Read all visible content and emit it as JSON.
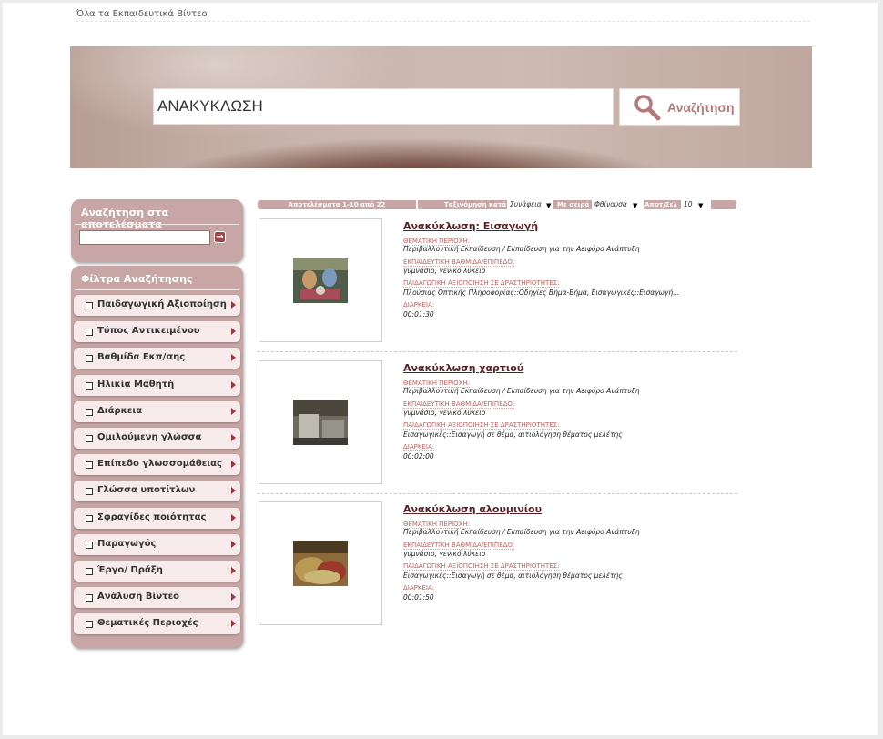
{
  "breadcrumb": "Όλα τα Εκπαιδευτικά Βίντεο",
  "search": {
    "value": "ΑΝΑΚΥΚΛΩΣΗ",
    "button_label": "Αναζήτηση"
  },
  "sidebar": {
    "search_title": "Αναζήτηση στα αποτελέσματα",
    "search_go": "→",
    "filters_title": "Φίλτρα Αναζήτησης",
    "filters": [
      "Παιδαγωγική Αξιοποίηση",
      "Τύπος Αντικειμένου",
      "Βαθμίδα Εκπ/σης",
      "Ηλικία Μαθητή",
      "Διάρκεια",
      "Ομιλούμενη γλώσσα",
      "Επίπεδο γλωσσομάθειας",
      "Γλώσσα υποτίτλων",
      "Σφραγίδες ποιότητας",
      "Παραγωγός",
      "Έργο/ Πράξη",
      "Ανάλυση Βίντεο",
      "Θεματικές Περιοχές"
    ]
  },
  "toolbar": {
    "results_count": "Αποτελέσματα 1-10 από 22",
    "sort_label": "Ταξινόμηση κατά",
    "sort_value": "Συνάφεια",
    "order_label": "Με σειρά",
    "order_value": "Φθίνουσα",
    "per_page_label": "Αποτ/Σελ",
    "per_page_value": "10",
    "dropdown_glyph": "▼"
  },
  "field_labels": {
    "subject": "ΘΕΜΑΤΙΚΗ ΠΕΡΙΟΧΗ:",
    "level": "ΕΚΠΑΙΔΕΥΤΙΚΗ ΒΑΘΜΙΔΑ/ΕΠΙΠΕΔΟ:",
    "pedagogy": "ΠΑΙΔΑΓΩΓΙΚΗ ΑΞΙΟΠΟΙΗΣΗ ΣΕ ΔΡΑΣΤΗΡΙΟΤΗΤΕΣ:",
    "duration": "ΔΙΑΡΚΕΙΑ:"
  },
  "results": [
    {
      "title": "Ανακύκλωση: Εισαγωγή",
      "subject": "Περιβαλλοντική Εκπαίδευση / Εκπαίδευση για την Αειφόρο Ανάπτυξη",
      "level": "γυμνάσιο, γενικό λύκειο",
      "pedagogy": "Πλούσιας Οπτικής Πληροφορίας::Οδηγίες Βήμα-Βήμα, Εισαγωγικές::Εισαγωγή...",
      "duration": "00:01:30"
    },
    {
      "title": "Ανακύκλωση χαρτιού",
      "subject": "Περιβαλλοντική Εκπαίδευση / Εκπαίδευση για την Αειφόρο Ανάπτυξη",
      "level": "γυμνάσιο, γενικό λύκειο",
      "pedagogy": "Εισαγωγικές::Εισαγωγή σε θέμα, αιτιολόγηση θέματος μελέτης",
      "duration": "00:02:00"
    },
    {
      "title": "Ανακύκλωση αλουμινίου",
      "subject": "Περιβαλλοντική Εκπαίδευση / Εκπαίδευση για την Αειφόρο Ανάπτυξη",
      "level": "γυμνάσιο, γενικό λύκειο",
      "pedagogy": "Εισαγωγικές::Εισαγωγή σε θέμα, αιτιολόγηση θέματος μελέτης",
      "duration": "00:01:50"
    }
  ],
  "colors": {
    "accent": "#c7a6a5",
    "title": "#5a1f22",
    "label": "#c0615e",
    "arrow": "#a0353a"
  }
}
